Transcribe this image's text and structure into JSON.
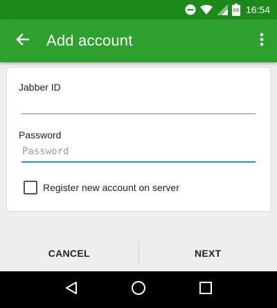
{
  "status_bar": {
    "time": "16:54",
    "icons": [
      "do-not-disturb-icon",
      "wifi-icon",
      "signal-icon",
      "battery-icon"
    ]
  },
  "app_bar": {
    "title": "Add account",
    "back_icon": "arrow-left-icon",
    "overflow_icon": "more-vert-icon"
  },
  "form": {
    "jid_label": "Jabber ID",
    "jid_value": "",
    "password_label": "Password",
    "password_placeholder": "Password",
    "password_value": "",
    "register_label": "Register new account on server",
    "register_checked": false
  },
  "actions": {
    "cancel_label": "CANCEL",
    "next_label": "NEXT"
  },
  "nav": {
    "back_icon": "triangle-back-icon",
    "home_icon": "circle-home-icon",
    "recents_icon": "square-recents-icon"
  },
  "colors": {
    "status_bar": "#1b8a1b",
    "app_bar": "#2ea02e",
    "focus_accent": "#1f8fd6"
  }
}
